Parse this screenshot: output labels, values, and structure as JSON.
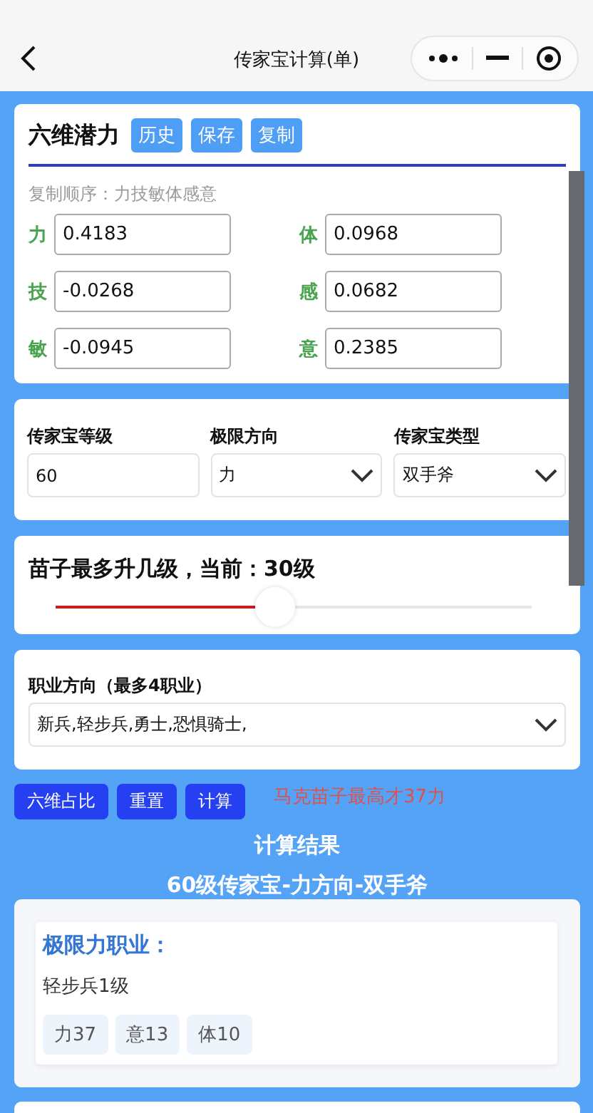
{
  "nav": {
    "title": "传家宝计算(单)"
  },
  "potential": {
    "title": "六维潜力",
    "actions": [
      "历史",
      "保存",
      "复制"
    ],
    "hint": "复制顺序：力技敏体感意",
    "stats": [
      {
        "label": "力",
        "value": "0.4183"
      },
      {
        "label": "体",
        "value": "0.0968"
      },
      {
        "label": "技",
        "value": "-0.0268"
      },
      {
        "label": "感",
        "value": "0.0682"
      },
      {
        "label": "敏",
        "value": "-0.0945"
      },
      {
        "label": "意",
        "value": "0.2385"
      }
    ]
  },
  "settings": [
    {
      "kind": "input",
      "label": "传家宝等级",
      "value": "60"
    },
    {
      "kind": "select",
      "label": "极限方向",
      "value": "力"
    },
    {
      "kind": "select",
      "label": "传家宝类型",
      "value": "双手斧"
    }
  ],
  "level_slider": {
    "label": "苗子最多升几级，当前：30级",
    "level": 0.46
  },
  "jobs": {
    "label": "职业方向（最多4职业）",
    "value": "新兵,轻步兵,勇士,恐惧骑士,"
  },
  "buttons": [
    "六维占比",
    "重置",
    "计算"
  ],
  "note": "马克苗子最高才37力",
  "result": {
    "title": "计算结果",
    "subtitle": "60级传家宝-力方向-双手斧",
    "cards": [
      {
        "heading": "极限力职业：",
        "text": "轻步兵1级",
        "tags": [
          "力37",
          "意13",
          "体10"
        ]
      }
    ]
  }
}
